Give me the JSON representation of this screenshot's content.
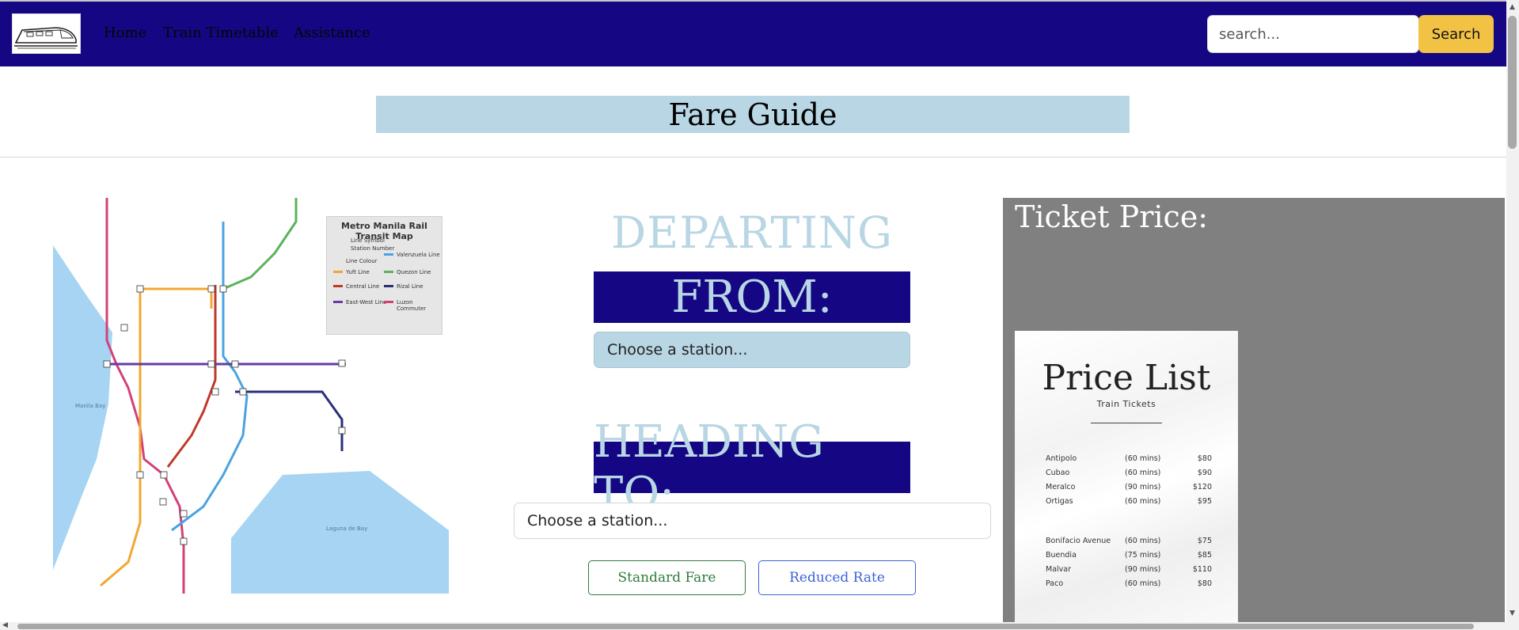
{
  "nav": {
    "links": [
      "Home",
      "Train Timetable",
      "Assistance"
    ],
    "search_placeholder": "search...",
    "search_button": "Search"
  },
  "page_title": "Fare Guide",
  "map": {
    "legend_title": "Metro Manila Rail Transit Map",
    "legend_items": [
      "Line Symbol",
      "Station Number",
      "Line Colour",
      "Yuft Line",
      "Valenzuela Line",
      "Quezon Line",
      "Central Line",
      "Rizal Line",
      "East-West Line",
      "Luzon Commuter"
    ],
    "water_labels": [
      "Manila Bay",
      "Laguna de Bay"
    ]
  },
  "form": {
    "departing": "DEPARTING",
    "from_label": "FROM:",
    "from_select": "Choose a station...",
    "heading_label": "HEADING TO:",
    "to_select": "Choose a station...",
    "standard_button": "Standard Fare",
    "reduced_button": "Reduced Rate"
  },
  "ticket": {
    "title": "Ticket Price:",
    "card_heading": "Price List",
    "card_sub": "Train Tickets",
    "rows": [
      {
        "name": "Antipolo",
        "time": "(60 mins)",
        "price": "$80"
      },
      {
        "name": "Cubao",
        "time": "(60 mins)",
        "price": "$90"
      },
      {
        "name": "Meralco",
        "time": "(90 mins)",
        "price": "$120"
      },
      {
        "name": "Ortigas",
        "time": "(60 mins)",
        "price": "$95"
      },
      {
        "name": "Bonifacio Avenue",
        "time": "(60 mins)",
        "price": "$75"
      },
      {
        "name": "Buendia",
        "time": "(75 mins)",
        "price": "$85"
      },
      {
        "name": "Malvar",
        "time": "(90 mins)",
        "price": "$110"
      },
      {
        "name": "Paco",
        "time": "(60 mins)",
        "price": "$80"
      }
    ]
  },
  "colors": {
    "navbar": "#150784",
    "accent_light": "#b8d6e4",
    "search_button": "#f1c244",
    "panel": "#808080",
    "standard_button": "#2f7a3a",
    "reduced_button": "#3a63d6"
  }
}
